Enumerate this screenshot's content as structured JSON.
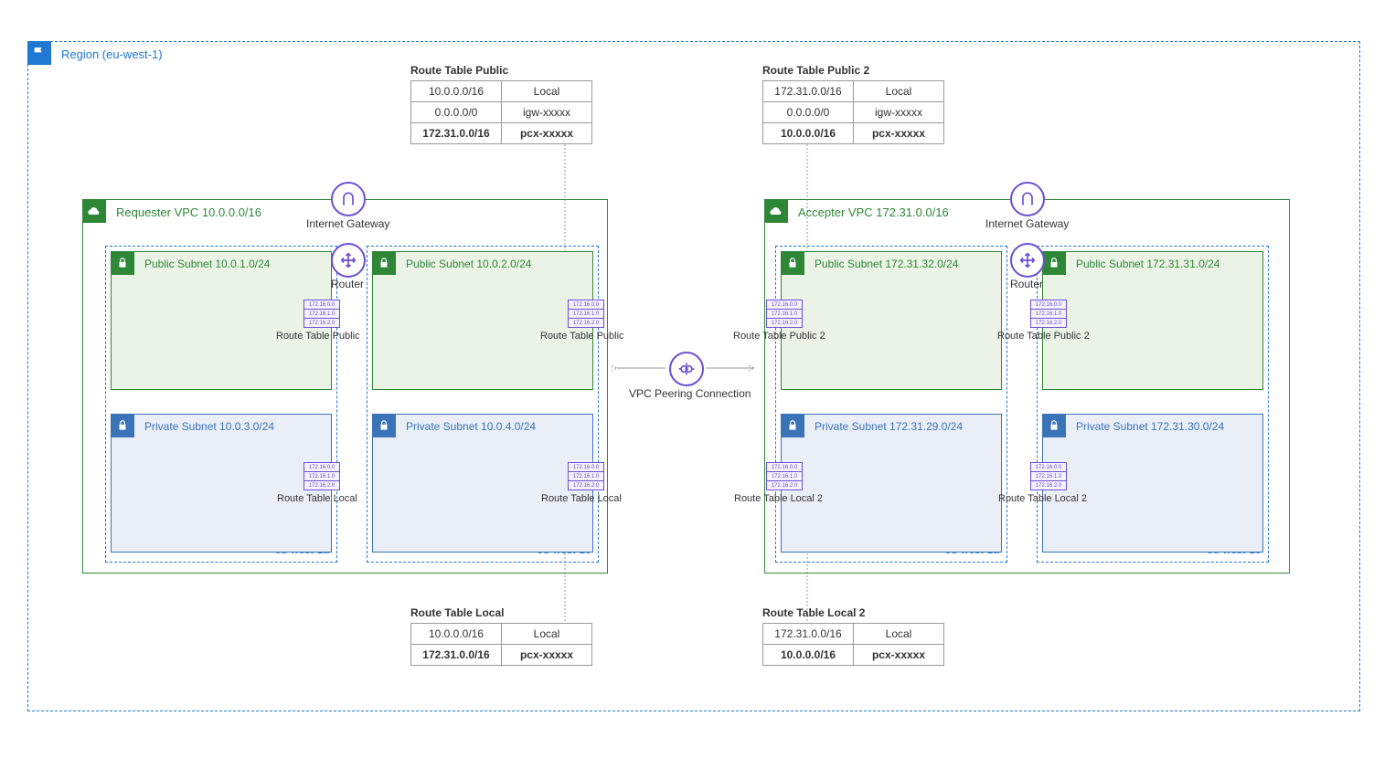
{
  "region_label": "Region (eu-west-1)",
  "peering_label": "VPC Peering Connection",
  "igw_label": "Internet Gateway",
  "router_label": "Router",
  "rt_mini_rows": [
    "172.16.0.0",
    "172.16.1.0",
    "172.16.2.0"
  ],
  "vpc1": {
    "label": "Requester VPC 10.0.0.0/16",
    "az_a": "eu-west-1a",
    "az_c": "eu-west-1c",
    "pub_a": "Public Subnet 10.0.1.0/24",
    "pub_c": "Public Subnet 10.0.2.0/24",
    "prv_a": "Private Subnet 10.0.3.0/24",
    "prv_c": "Private Subnet 10.0.4.0/24",
    "rt_pub_label": "Route Table Public",
    "rt_loc_label": "Route Table Local"
  },
  "vpc2": {
    "label": "Accepter VPC 172.31.0.0/16",
    "az_a": "eu-west-1a",
    "az_c": "eu-west-1c",
    "pub_a": "Public Subnet 172.31.32.0/24",
    "pub_c": "Public Subnet 172.31.31.0/24",
    "prv_a": "Private Subnet 172.31.29.0/24",
    "prv_c": "Private Subnet 172.31.30.0/24",
    "rt_pub_label": "Route Table Public 2",
    "rt_loc_label": "Route Table Local 2"
  },
  "rt_public_1": {
    "title": "Route Table Public",
    "rows": [
      {
        "dest": "10.0.0.0/16",
        "target": "Local",
        "bold": false
      },
      {
        "dest": "0.0.0.0/0",
        "target": "igw-xxxxx",
        "bold": false
      },
      {
        "dest": "172.31.0.0/16",
        "target": "pcx-xxxxx",
        "bold": true
      }
    ]
  },
  "rt_public_2": {
    "title": "Route Table Public 2",
    "rows": [
      {
        "dest": "172.31.0.0/16",
        "target": "Local",
        "bold": false
      },
      {
        "dest": "0.0.0.0/0",
        "target": "igw-xxxxx",
        "bold": false
      },
      {
        "dest": "10.0.0.0/16",
        "target": "pcx-xxxxx",
        "bold": true
      }
    ]
  },
  "rt_local_1": {
    "title": "Route Table Local",
    "rows": [
      {
        "dest": "10.0.0.0/16",
        "target": "Local",
        "bold": false
      },
      {
        "dest": "172.31.0.0/16",
        "target": "pcx-xxxxx",
        "bold": true
      }
    ]
  },
  "rt_local_2": {
    "title": "Route Table Local 2",
    "rows": [
      {
        "dest": "172.31.0.0/16",
        "target": "Local",
        "bold": false
      },
      {
        "dest": "10.0.0.0/16",
        "target": "pcx-xxxxx",
        "bold": true
      }
    ]
  }
}
